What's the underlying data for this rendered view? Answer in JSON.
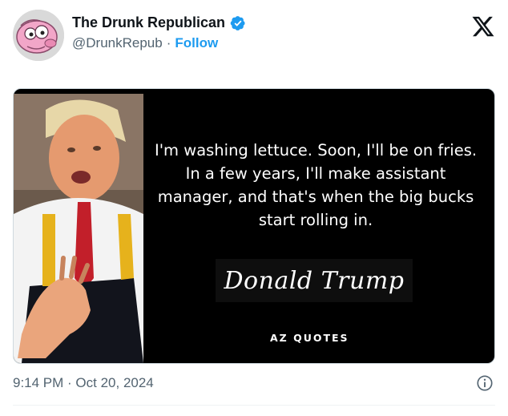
{
  "account": {
    "display_name": "The Drunk Republican",
    "handle": "@DrunkRepub",
    "separator": "·",
    "follow_label": "Follow",
    "verified_icon": "verified-badge-icon",
    "avatar_icon": "pink-cartoon-avatar"
  },
  "brand": {
    "logo_icon": "x-logo-icon"
  },
  "media": {
    "quote_text": "I'm washing lettuce. Soon, I'll be on fries. In a few years, I'll make assistant manager, and that's when the big bucks start rolling in.",
    "author_signature": "Donald Trump",
    "source_brand": "AZ QUOTES",
    "photo_icon": "man-in-apron-photo"
  },
  "footer": {
    "timestamp": "9:14 PM · Oct 20, 2024",
    "info_icon": "info-icon"
  },
  "colors": {
    "accent": "#1d9bf0",
    "text": "#0f1419",
    "muted": "#536471",
    "avatar_pink": "#f2a6c8"
  }
}
